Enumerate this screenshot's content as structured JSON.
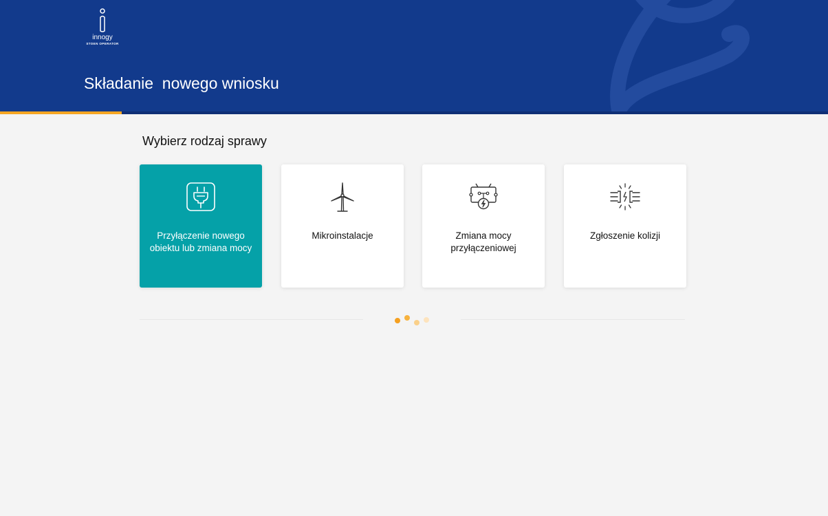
{
  "header": {
    "brand": "innogy",
    "brand_sub": "STOEN OPERATOR",
    "title": "Składanie  nowego wniosku"
  },
  "main": {
    "section_title": "Wybierz rodzaj sprawy",
    "cards": [
      {
        "label": "Przyłączenie nowego obiektu lub zmiana mocy",
        "icon": "plug-icon",
        "selected": true
      },
      {
        "label": "Mikroinstalacje",
        "icon": "wind-turbine-icon",
        "selected": false
      },
      {
        "label": "Zmiana mocy przyłączeniowej",
        "icon": "power-circuit-icon",
        "selected": false
      },
      {
        "label": "Zgłoszenie kolizji",
        "icon": "collision-spark-icon",
        "selected": false
      }
    ]
  },
  "colors": {
    "header_bg": "#123a8c",
    "accent": "#f5a623",
    "selected_card": "#05a1a8",
    "page_bg": "#f4f4f4"
  }
}
